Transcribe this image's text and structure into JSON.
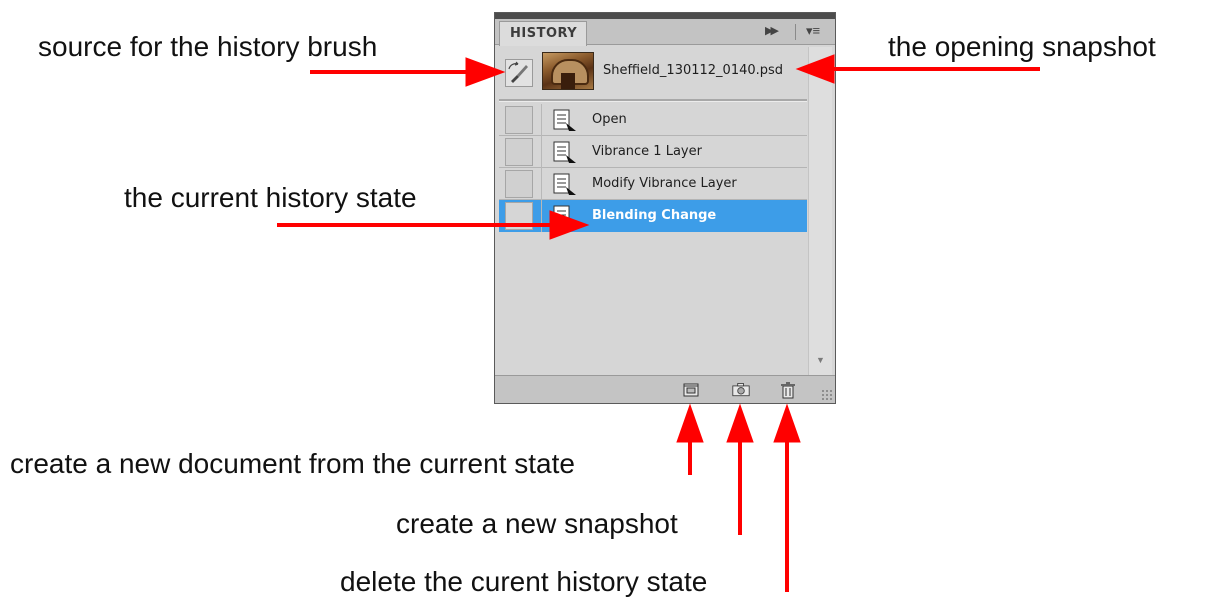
{
  "panel": {
    "tab_label": "HISTORY",
    "collapse_icon": "double-right-arrow-icon",
    "menu_icon": "panel-menu-icon",
    "snapshot": {
      "name": "Sheffield_130112_0140.psd",
      "brush_icon": "history-brush-icon",
      "thumbnail_icon": "snapshot-thumbnail"
    },
    "states": [
      {
        "label": "Open",
        "current": false
      },
      {
        "label": "Vibrance 1 Layer",
        "current": false
      },
      {
        "label": "Modify Vibrance Layer",
        "current": false
      },
      {
        "label": "Blending Change",
        "current": true
      }
    ],
    "bottom_buttons": [
      {
        "name": "new-document-from-state",
        "icon": "new-document-icon"
      },
      {
        "name": "create-new-snapshot",
        "icon": "camera-icon"
      },
      {
        "name": "delete-state",
        "icon": "trash-icon"
      }
    ],
    "colors": {
      "selection": "#3d9de8",
      "panel_bg": "#d6d6d6",
      "arrow": "#ff0000"
    }
  },
  "annotations": {
    "source_brush": "source for the history brush",
    "opening_snapshot": "the opening snapshot",
    "current_state": "the current history state",
    "new_document": "create a new document from the current state",
    "new_snapshot": "create a new snapshot",
    "delete_state": "delete the curent history state"
  }
}
